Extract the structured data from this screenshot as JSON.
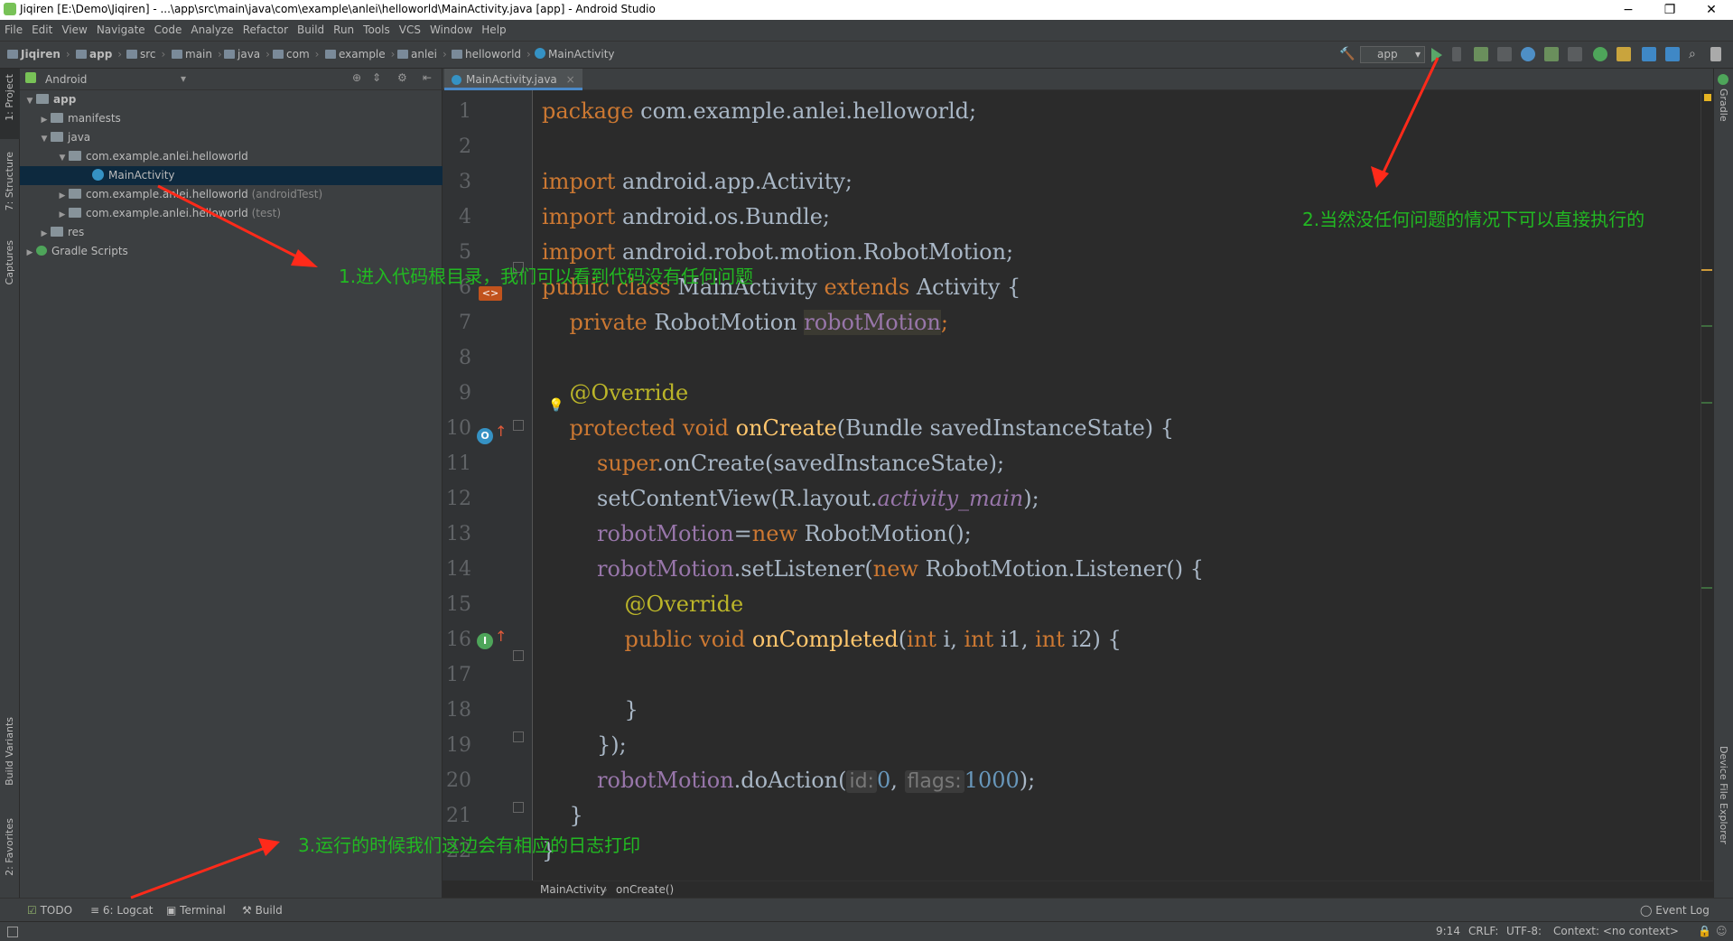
{
  "window": {
    "title": "Jiqiren [E:\\Demo\\Jiqiren] - ...\\app\\src\\main\\java\\com\\example\\anlei\\helloworld\\MainActivity.java [app] - Android Studio",
    "minimize": "−",
    "maximize": "❐",
    "close": "✕"
  },
  "menu": [
    "File",
    "Edit",
    "View",
    "Navigate",
    "Code",
    "Analyze",
    "Refactor",
    "Build",
    "Run",
    "Tools",
    "VCS",
    "Window",
    "Help"
  ],
  "breadcrumbs": [
    "Jiqiren",
    "app",
    "src",
    "main",
    "java",
    "com",
    "example",
    "anlei",
    "helloworld",
    "MainActivity"
  ],
  "toolbar": {
    "run_config": "app"
  },
  "left_tool_windows": [
    "1: Project",
    "7: Structure",
    "Captures",
    "Build Variants",
    "2: Favorites"
  ],
  "right_tool_windows": [
    "Gradle",
    "Device File Explorer"
  ],
  "project": {
    "view_mode": "Android",
    "tree": [
      {
        "label": "app",
        "note": ""
      },
      {
        "label": "manifests",
        "note": ""
      },
      {
        "label": "java",
        "note": ""
      },
      {
        "label": "com.example.anlei.helloworld",
        "note": ""
      },
      {
        "label": "MainActivity",
        "note": ""
      },
      {
        "label": "com.example.anlei.helloworld",
        "note": "(androidTest)"
      },
      {
        "label": "com.example.anlei.helloworld",
        "note": "(test)"
      },
      {
        "label": "res",
        "note": ""
      },
      {
        "label": "Gradle Scripts",
        "note": ""
      }
    ]
  },
  "editor": {
    "tab": "MainActivity.java",
    "line_numbers": [
      "1",
      "2",
      "3",
      "4",
      "5",
      "6",
      "7",
      "8",
      "9",
      "10",
      "11",
      "12",
      "13",
      "14",
      "15",
      "16",
      "17",
      "18",
      "19",
      "20",
      "21",
      "22"
    ],
    "code": {
      "l1a": "package",
      "l1b": " com.example.anlei.helloworld;",
      "l3a": "import",
      "l3b": " android.app.Activity;",
      "l4a": "import",
      "l4b": " android.os.Bundle;",
      "l5a": "import",
      "l5b": " android.robot.motion.RobotMotion;",
      "l6a": "public class",
      "l6b": " MainActivity ",
      "l6c": "extends",
      "l6d": " Activity {",
      "l7a": "    private",
      "l7b": " RobotMotion ",
      "l7c": "robotMotion",
      "l7d": ";",
      "l9": "    @Override",
      "l10a": "    protected void",
      "l10b": " onCreate",
      "l10c": "(Bundle savedInstanceState) {",
      "l11a": "        super",
      "l11b": ".onCreate(savedInstanceState);",
      "l12a": "        setContentView(R.layout.",
      "l12b": "activity_main",
      "l12c": ");",
      "l13a": "        robotMotion",
      "l13b": "=",
      "l13c": "new",
      "l13d": " RobotMotion();",
      "l14a": "        robotMotion",
      "l14b": ".setListener(",
      "l14c": "new",
      "l14d": " RobotMotion.Listener() {",
      "l15": "            @Override",
      "l16a": "            public void",
      "l16b": " onCompleted",
      "l16c": "(",
      "l16d": "int",
      "l16e": " i, ",
      "l16f": "int",
      "l16g": " i1, ",
      "l16h": "int",
      "l16i": " i2) {",
      "l18": "            }",
      "l19": "        });",
      "l20a": "        robotMotion",
      "l20b": ".doAction(",
      "l20c": "id:",
      "l20d": "0",
      "l20e": ", ",
      "l20f": "flags:",
      "l20g": "1000",
      "l20h": ");",
      "l21": "    }",
      "l22": "}"
    },
    "breadcrumb": [
      "MainActivity",
      "onCreate()"
    ]
  },
  "bottom_tools": [
    "TODO",
    "6: Logcat",
    "Terminal",
    "Build"
  ],
  "event_log": "Event Log",
  "status": {
    "position": "9:14",
    "line_sep": "CRLF:",
    "encoding": "UTF-8:",
    "context": "Context: <no context>"
  },
  "annotations": {
    "a1": "1.进入代码根目录，我们可以看到代码没有任何问题",
    "a2": "2.当然没任何问题的情况下可以直接执行的",
    "a3": "3.运行的时候我们这边会有相应的日志打印"
  },
  "colors": {
    "annotation": "#22b922",
    "arrow": "#ff2a1a",
    "keyword": "#cc7832",
    "field": "#9876aa",
    "method": "#ffc66d",
    "annotation_code": "#bbb529",
    "number": "#6897bb"
  }
}
